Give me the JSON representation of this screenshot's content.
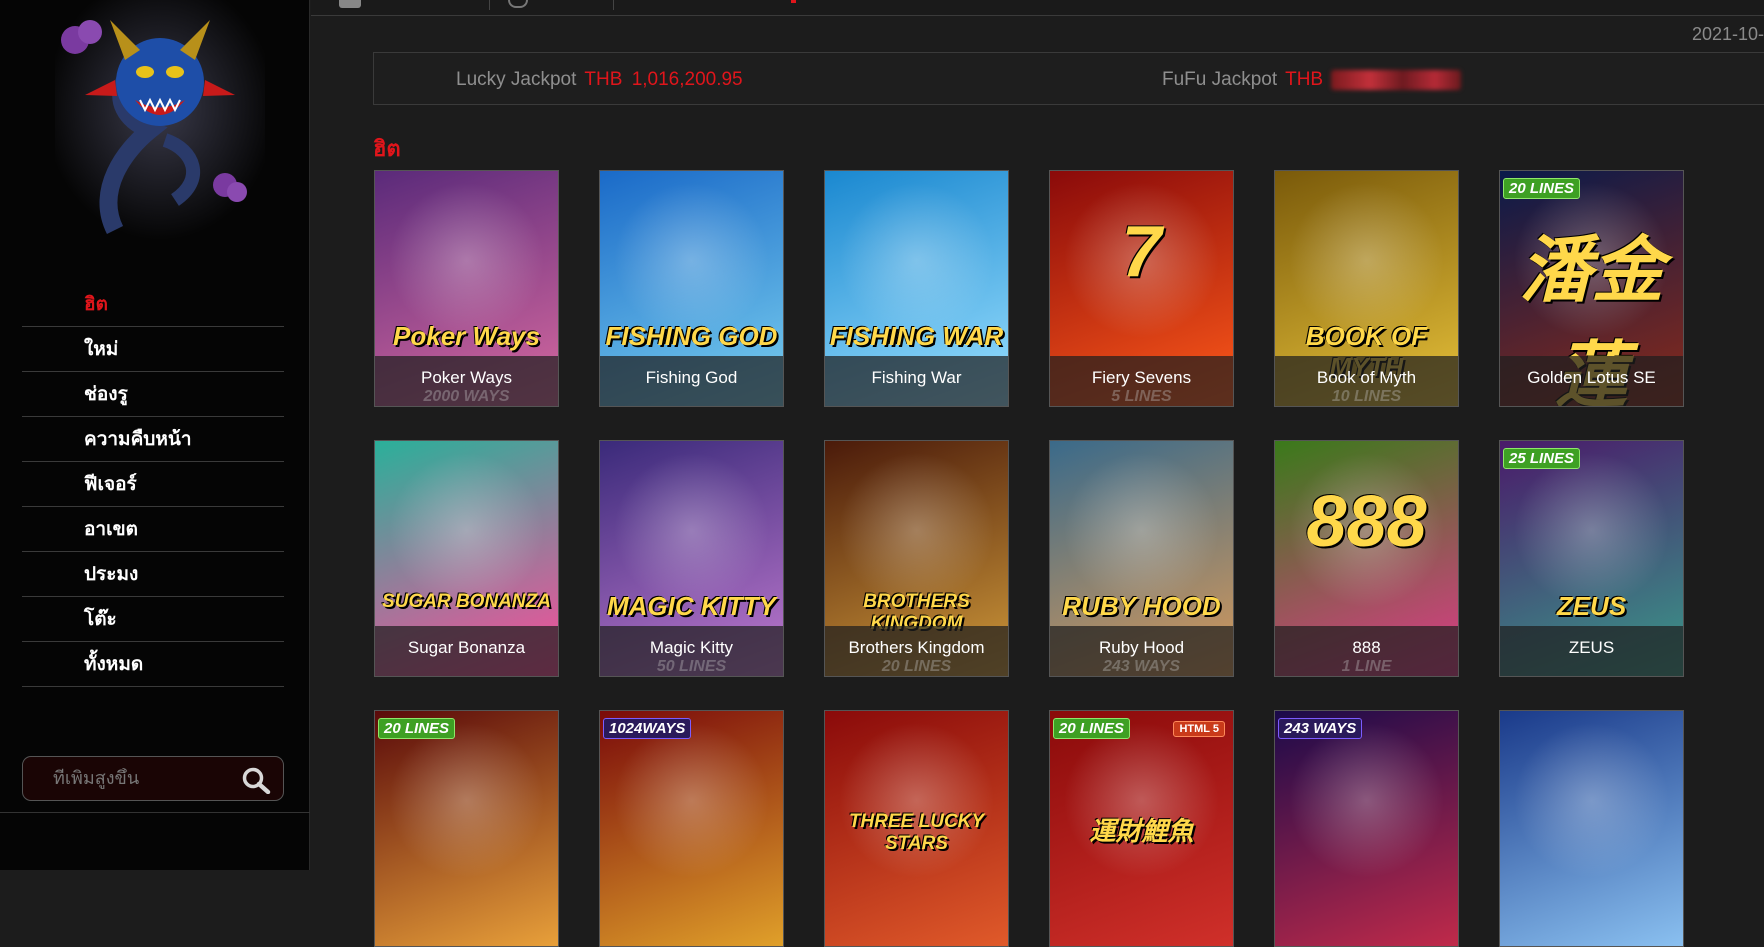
{
  "sidebar": {
    "nav": [
      {
        "label": "ฮิต",
        "active": true
      },
      {
        "label": "ใหม่",
        "active": false
      },
      {
        "label": "ช่องรู",
        "active": false
      },
      {
        "label": "ความคืบหน้า",
        "active": false
      },
      {
        "label": "ฟีเจอร์",
        "active": false
      },
      {
        "label": "อาเขต",
        "active": false
      },
      {
        "label": "ประมง",
        "active": false
      },
      {
        "label": "โต๊ะ",
        "active": false
      },
      {
        "label": "ทั้งหมด",
        "active": false
      }
    ],
    "search_placeholder": "ที่เพิ่มสูงขึ้น"
  },
  "header": {
    "date": "2021-10-"
  },
  "jackpots": {
    "lucky": {
      "label": "Lucky Jackpot",
      "currency": "THB",
      "amount": "1,016,200.95"
    },
    "fufu": {
      "label": "FuFu Jackpot",
      "currency": "THB"
    }
  },
  "section": {
    "title": "ฮิต"
  },
  "games": [
    {
      "name": "Poker Ways",
      "sub": "2000 WAYS",
      "art": "Poker Ways",
      "bg": [
        "#5a2a7a",
        "#d86aa0"
      ],
      "badge": ""
    },
    {
      "name": "Fishing God",
      "sub": "",
      "art": "FISHING GOD",
      "bg": [
        "#1a6ac8",
        "#7ad0f0"
      ],
      "badge": ""
    },
    {
      "name": "Fishing War",
      "sub": "",
      "art": "FISHING WAR",
      "bg": [
        "#1a88d0",
        "#9ae0ff"
      ],
      "badge": ""
    },
    {
      "name": "Fiery Sevens",
      "sub": "5 LINES",
      "art": "7",
      "bg": [
        "#8a0a0a",
        "#ff5a1a"
      ],
      "badge": ""
    },
    {
      "name": "Book of Myth",
      "sub": "10 LINES",
      "art": "BOOK OF MYTH",
      "bg": [
        "#7a5a0a",
        "#e8c23a"
      ],
      "badge": ""
    },
    {
      "name": "Golden Lotus SE",
      "sub": "",
      "art": "潘金蓮",
      "bg": [
        "#0a1a4a",
        "#8a2a1a"
      ],
      "badge": "20 LINES"
    },
    {
      "name": "Sugar Bonanza",
      "sub": "",
      "art": "SUGAR BONANZA",
      "bg": [
        "#2ab09a",
        "#ff4a9a"
      ],
      "badge": ""
    },
    {
      "name": "Magic Kitty",
      "sub": "50 LINES",
      "art": "MAGIC KITTY",
      "bg": [
        "#3a2a7a",
        "#c07ad0"
      ],
      "badge": ""
    },
    {
      "name": "Brothers Kingdom",
      "sub": "20 LINES",
      "art": "BROTHERS KINGDOM",
      "bg": [
        "#4a1a0a",
        "#d09a3a"
      ],
      "badge": ""
    },
    {
      "name": "Ruby Hood",
      "sub": "243 WAYS",
      "art": "RUBY HOOD",
      "bg": [
        "#3a6a8a",
        "#d89a5a"
      ],
      "badge": ""
    },
    {
      "name": "888",
      "sub": "1 LINE",
      "art": "888",
      "bg": [
        "#3a7a1a",
        "#e03a8a"
      ],
      "badge": ""
    },
    {
      "name": "ZEUS",
      "sub": "",
      "art": "ZEUS",
      "bg": [
        "#4a1a6a",
        "#3a9a8a"
      ],
      "badge": "25 LINES"
    },
    {
      "name": "",
      "sub": "",
      "art": "",
      "bg": [
        "#5a0a0a",
        "#e8a03a"
      ],
      "badge": "20 LINES"
    },
    {
      "name": "",
      "sub": "",
      "art": "",
      "bg": [
        "#7a0a0a",
        "#e0a02a"
      ],
      "badge": "1024WAYS"
    },
    {
      "name": "",
      "sub": "",
      "art": "THREE LUCKY STARS",
      "bg": [
        "#8a0a0a",
        "#e05a2a"
      ],
      "badge": ""
    },
    {
      "name": "",
      "sub": "",
      "art": "運財鯉魚",
      "bg": [
        "#8a0a0a",
        "#d0302a"
      ],
      "badge": "20 LINES",
      "badge2": "HTML 5"
    },
    {
      "name": "",
      "sub": "",
      "art": "",
      "bg": [
        "#1a0a4a",
        "#c02a4a"
      ],
      "badge": "243 WAYS"
    },
    {
      "name": "",
      "sub": "",
      "art": "",
      "bg": [
        "#1a3a8a",
        "#8ac0f0"
      ],
      "badge": ""
    }
  ]
}
